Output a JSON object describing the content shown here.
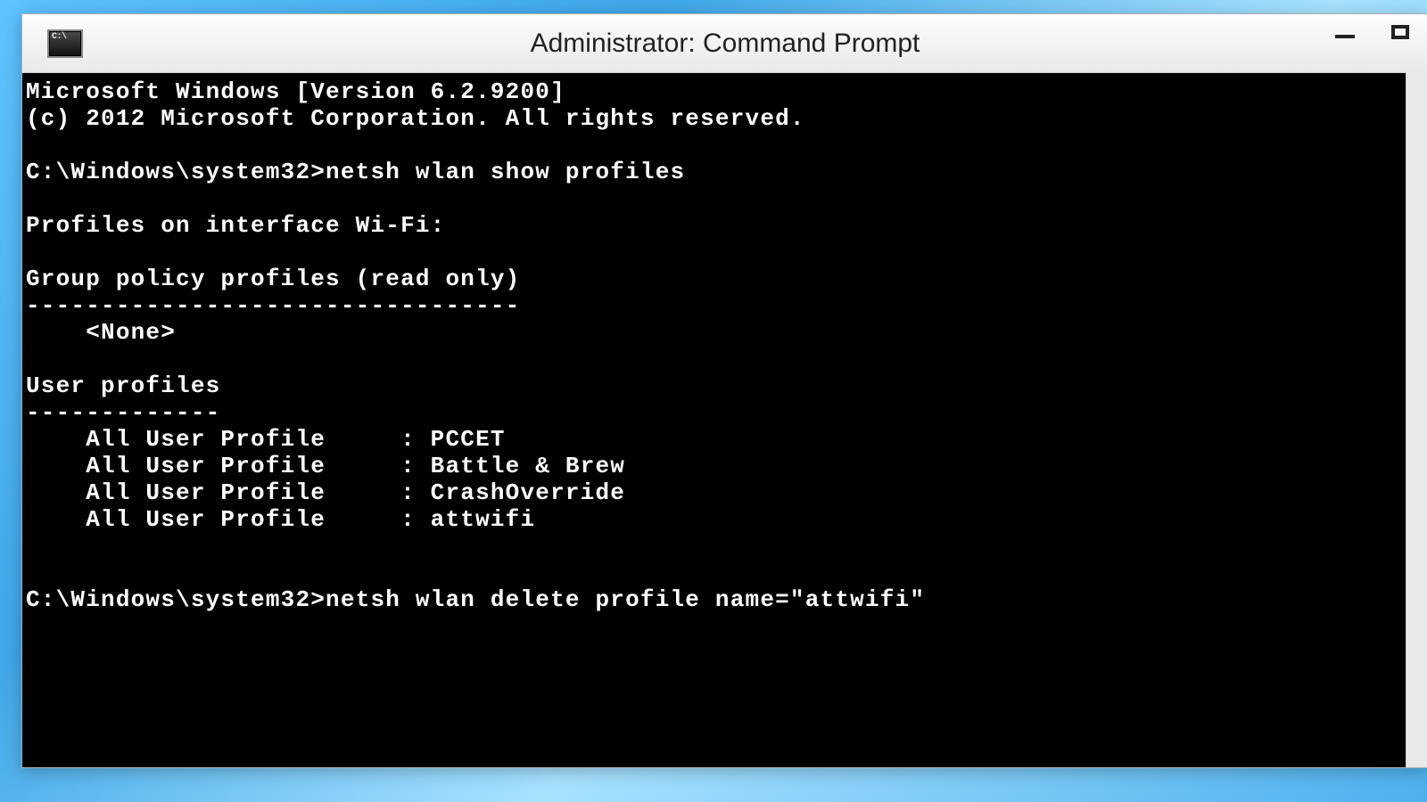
{
  "window": {
    "title": "Administrator: Command Prompt"
  },
  "terminal": {
    "lines": [
      "Microsoft Windows [Version 6.2.9200]",
      "(c) 2012 Microsoft Corporation. All rights reserved.",
      "",
      "C:\\Windows\\system32>netsh wlan show profiles",
      "",
      "Profiles on interface Wi-Fi:",
      "",
      "Group policy profiles (read only)",
      "---------------------------------",
      "    <None>",
      "",
      "User profiles",
      "-------------",
      "    All User Profile     : PCCET",
      "    All User Profile     : Battle & Brew",
      "    All User Profile     : CrashOverride",
      "    All User Profile     : attwifi",
      "",
      "",
      "C:\\Windows\\system32>netsh wlan delete profile name=\"attwifi\"",
      ""
    ]
  }
}
